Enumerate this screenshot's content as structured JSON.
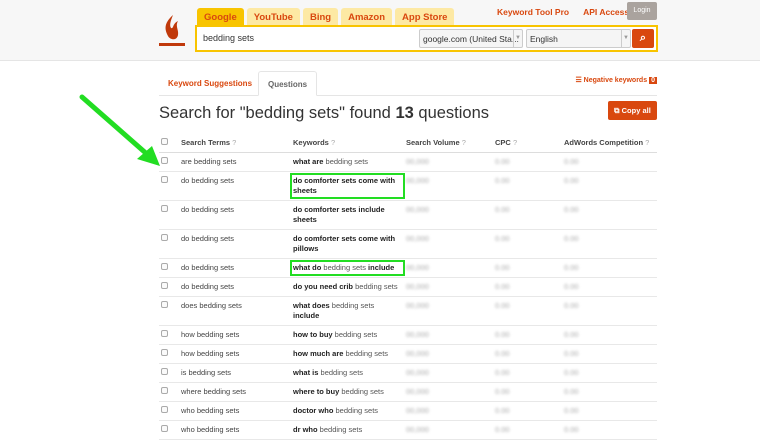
{
  "header": {
    "engine_tabs": [
      "Google",
      "YouTube",
      "Bing",
      "Amazon",
      "App Store"
    ],
    "active_tab": 0,
    "search_value": "bedding sets",
    "domain_select": "google.com (United Sta...",
    "language_select": "English",
    "links": [
      "Keyword Tool Pro",
      "API Access"
    ],
    "login_label": "Login"
  },
  "subtabs": {
    "suggestions": "Keyword Suggestions",
    "questions": "Questions",
    "negative_label": "Negative keywords",
    "negative_count": "0"
  },
  "title": {
    "prefix": "Search for \"bedding sets\" found ",
    "count": "13",
    "suffix": " questions"
  },
  "copy_all": "Copy all",
  "table": {
    "columns": [
      "Search Terms",
      "Keywords",
      "Search Volume",
      "CPC",
      "AdWords Competition"
    ],
    "help": "?",
    "rows": [
      {
        "term": "are bedding sets",
        "kw": [
          {
            "t": "what are",
            "b": true
          },
          {
            "t": " bedding sets",
            "b": false
          }
        ],
        "vol": "00,000",
        "cpc": "0.00",
        "comp": "0.00"
      },
      {
        "term": "do bedding sets",
        "kw": [
          {
            "t": "do comforter sets come with sheets",
            "b": true
          }
        ],
        "vol": "00,000",
        "cpc": "0.00",
        "comp": "0.00",
        "hl": true
      },
      {
        "term": "do bedding sets",
        "kw": [
          {
            "t": "do comforter sets include sheets",
            "b": true
          }
        ],
        "vol": "00,000",
        "cpc": "0.00",
        "comp": "0.00"
      },
      {
        "term": "do bedding sets",
        "kw": [
          {
            "t": "do comforter sets come with pillows",
            "b": true
          }
        ],
        "vol": "00,000",
        "cpc": "0.00",
        "comp": "0.00"
      },
      {
        "term": "do bedding sets",
        "kw": [
          {
            "t": "what do",
            "b": true
          },
          {
            "t": " bedding sets ",
            "b": false
          },
          {
            "t": "include",
            "b": true
          }
        ],
        "vol": "00,000",
        "cpc": "0.00",
        "comp": "0.00",
        "hl": true
      },
      {
        "term": "do bedding sets",
        "kw": [
          {
            "t": "do you need crib",
            "b": true
          },
          {
            "t": " bedding sets",
            "b": false
          }
        ],
        "vol": "00,000",
        "cpc": "0.00",
        "comp": "0.00"
      },
      {
        "term": "does bedding sets",
        "kw": [
          {
            "t": "what does",
            "b": true
          },
          {
            "t": " bedding sets ",
            "b": false
          },
          {
            "t": "include",
            "b": true
          }
        ],
        "vol": "00,000",
        "cpc": "0.00",
        "comp": "0.00"
      },
      {
        "term": "how bedding sets",
        "kw": [
          {
            "t": "how to buy",
            "b": true
          },
          {
            "t": " bedding sets",
            "b": false
          }
        ],
        "vol": "00,000",
        "cpc": "0.00",
        "comp": "0.00"
      },
      {
        "term": "how bedding sets",
        "kw": [
          {
            "t": "how much are",
            "b": true
          },
          {
            "t": " bedding sets",
            "b": false
          }
        ],
        "vol": "00,000",
        "cpc": "0.00",
        "comp": "0.00"
      },
      {
        "term": "is bedding sets",
        "kw": [
          {
            "t": "what is",
            "b": true
          },
          {
            "t": " bedding sets",
            "b": false
          }
        ],
        "vol": "00,000",
        "cpc": "0.00",
        "comp": "0.00"
      },
      {
        "term": "where bedding sets",
        "kw": [
          {
            "t": "where to buy",
            "b": true
          },
          {
            "t": " bedding sets",
            "b": false
          }
        ],
        "vol": "00,000",
        "cpc": "0.00",
        "comp": "0.00"
      },
      {
        "term": "who bedding sets",
        "kw": [
          {
            "t": "doctor who",
            "b": true
          },
          {
            "t": " bedding sets",
            "b": false
          }
        ],
        "vol": "00,000",
        "cpc": "0.00",
        "comp": "0.00"
      },
      {
        "term": "who bedding sets",
        "kw": [
          {
            "t": "dr who",
            "b": true
          },
          {
            "t": " bedding sets",
            "b": false
          }
        ],
        "vol": "00,000",
        "cpc": "0.00",
        "comp": "0.00"
      }
    ]
  },
  "colors": {
    "accent": "#d9480f",
    "tab_yellow": "#f8c400",
    "annotation_green": "#22dd22"
  }
}
